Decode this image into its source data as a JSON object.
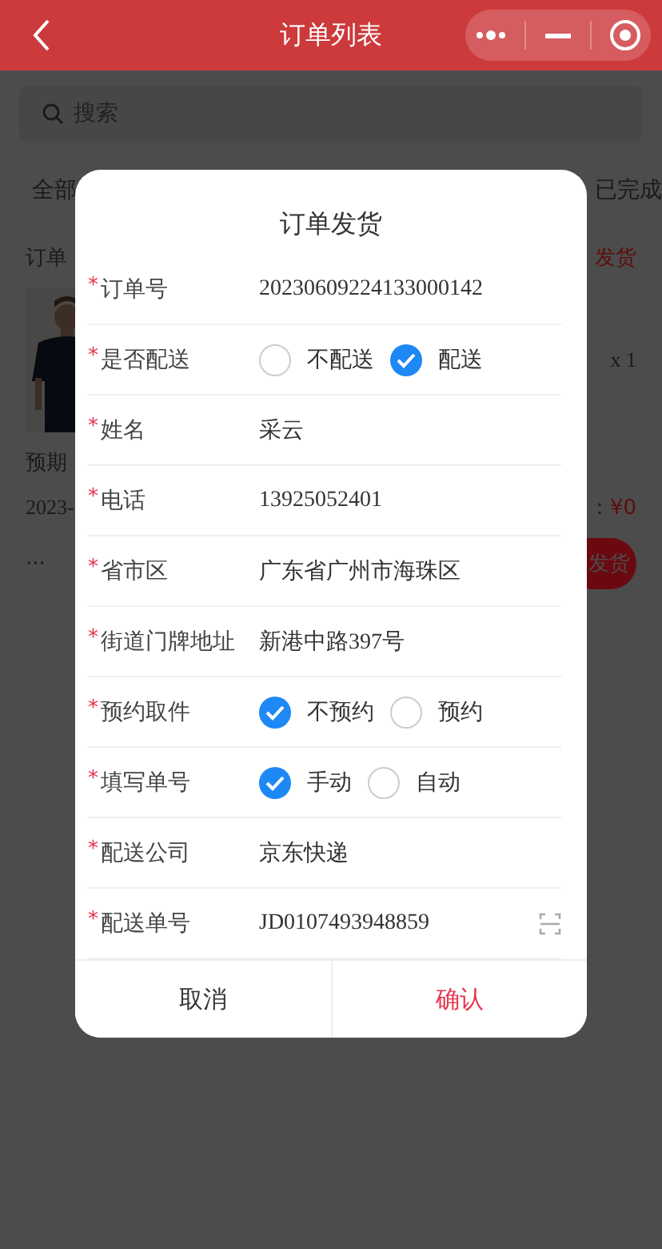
{
  "nav": {
    "title": "订单列表"
  },
  "search": {
    "placeholder": "搜索"
  },
  "tabs": [
    {
      "label": "全部"
    },
    {
      "label": "已完成"
    }
  ],
  "order": {
    "number_label": "订单",
    "status": "发货",
    "quantity": "x 1",
    "expected": "预期",
    "date": "2023-",
    "total_label": "：",
    "total": "¥0",
    "more": "···",
    "action": "发货"
  },
  "dialog": {
    "title": "订单发货",
    "fields": [
      {
        "kind": "text",
        "mark": "*",
        "label": "订单号",
        "value": "20230609224133000142"
      },
      {
        "kind": "radio",
        "mark": "*",
        "label": "是否配送",
        "options": [
          {
            "label": "不配送",
            "selected": false
          },
          {
            "label": "配送",
            "selected": true
          }
        ]
      },
      {
        "kind": "text",
        "mark": "*",
        "label": "姓名",
        "value": "采云"
      },
      {
        "kind": "text",
        "mark": "*",
        "label": "电话",
        "value": "13925052401"
      },
      {
        "kind": "text",
        "mark": "*",
        "label": "省市区",
        "value": "广东省广州市海珠区"
      },
      {
        "kind": "text",
        "mark": "*",
        "label": "街道门牌地址",
        "value": "新港中路397号"
      },
      {
        "kind": "radio",
        "mark": "*",
        "label": "预约取件",
        "options": [
          {
            "label": "不预约",
            "selected": true
          },
          {
            "label": "预约",
            "selected": false
          }
        ]
      },
      {
        "kind": "radio",
        "mark": "*",
        "label": "填写单号",
        "options": [
          {
            "label": "手动",
            "selected": true
          },
          {
            "label": "自动",
            "selected": false
          }
        ]
      },
      {
        "kind": "text",
        "mark": "*",
        "label": "配送公司",
        "value": "京东快递"
      },
      {
        "kind": "scan",
        "mark": "*",
        "label": "配送单号",
        "value": "JD0107493948859"
      }
    ],
    "buttons": [
      {
        "kind": "cancel",
        "label": "取消"
      },
      {
        "kind": "confirm",
        "label": "确认"
      }
    ]
  }
}
